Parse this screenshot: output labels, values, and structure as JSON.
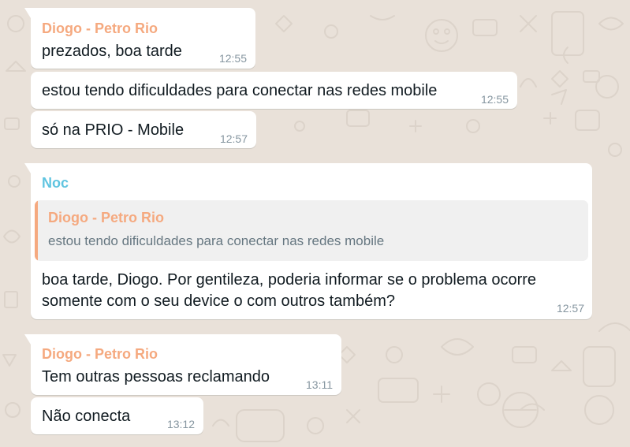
{
  "colors": {
    "background": "#e9e1d9",
    "bubble": "#ffffff",
    "diogo_name": "#f5a97f",
    "noc_name": "#5fc4e0",
    "quote_bar": "#f5a97f",
    "time": "#8696a0"
  },
  "messages": [
    {
      "sender": "Diogo - Petro Rio",
      "text": "prezados, boa tarde",
      "time": "12:55"
    },
    {
      "text": "estou tendo dificuldades para conectar nas redes mobile",
      "time": "12:55"
    },
    {
      "text": "só na PRIO - Mobile",
      "time": "12:57"
    },
    {
      "sender": "Noc",
      "quote": {
        "sender": "Diogo - Petro Rio",
        "text": "estou tendo dificuldades para conectar nas redes mobile"
      },
      "text_lines": [
        "boa tarde, Diogo. Por gentileza, poderia informar se o problema ocorre",
        "somente com o seu device o com outros também?"
      ],
      "time": "12:57"
    },
    {
      "sender": "Diogo - Petro Rio",
      "text": "Tem outras pessoas reclamando",
      "time": "13:11"
    },
    {
      "text": "Não conecta",
      "time": "13:12"
    }
  ]
}
